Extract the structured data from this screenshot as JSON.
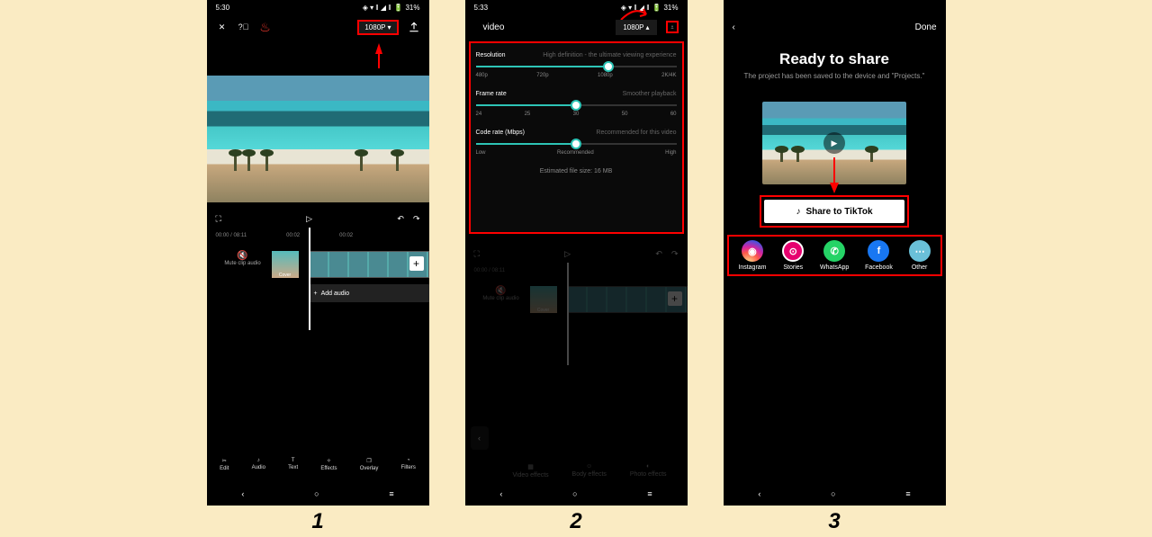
{
  "status": {
    "time1": "5:30",
    "time2": "5:33",
    "battery": "31%",
    "net_badge": "⋈"
  },
  "screen1": {
    "resolution_label": "1080P",
    "time_current": "00:00",
    "time_total": "08:11",
    "timeline_marks": [
      "00:00",
      "00:02",
      "00:02"
    ],
    "muteclip": "Mute clip audio",
    "cover": "Cover",
    "add_audio": "Add audio",
    "add_clip": "+",
    "tools": [
      {
        "icon": "scissors",
        "label": "Edit"
      },
      {
        "icon": "music",
        "label": "Audio"
      },
      {
        "icon": "T",
        "label": "Text"
      },
      {
        "icon": "sparkle",
        "label": "Effects"
      },
      {
        "icon": "layers",
        "label": "Overlay"
      },
      {
        "icon": "filter",
        "label": "Filters"
      }
    ]
  },
  "screen2": {
    "title": "video",
    "resolution_label": "1080P",
    "res": {
      "label": "Resolution",
      "hint": "High definition - the ultimate viewing experience",
      "marks": [
        "480p",
        "720p",
        "1080p",
        "2K/4K"
      ],
      "pos": 66
    },
    "fr": {
      "label": "Frame rate",
      "hint": "Smoother playback",
      "marks": [
        "24",
        "25",
        "30",
        "50",
        "60"
      ],
      "pos": 50
    },
    "cr": {
      "label": "Code rate (Mbps)",
      "hint": "Recommended for this video",
      "marks": [
        "Low",
        "Recommended",
        "High"
      ],
      "pos": 50
    },
    "filesize": "Estimated file size: 16 MB",
    "tools2": [
      {
        "label": "Video effects"
      },
      {
        "label": "Body effects"
      },
      {
        "label": "Photo effects"
      }
    ]
  },
  "screen3": {
    "done": "Done",
    "title": "Ready to share",
    "sub": "The project has been saved to the device and \"Projects.\"",
    "tiktok": "Share to TikTok",
    "shares": [
      {
        "cls": "ig",
        "glyph": "◉",
        "label": "Instagram"
      },
      {
        "cls": "st",
        "glyph": "⊙",
        "label": "Stories"
      },
      {
        "cls": "wa",
        "glyph": "✆",
        "label": "WhatsApp"
      },
      {
        "cls": "fb",
        "glyph": "f",
        "label": "Facebook"
      },
      {
        "cls": "ot",
        "glyph": "⋯",
        "label": "Other"
      }
    ]
  },
  "steps": [
    "1",
    "2",
    "3"
  ]
}
